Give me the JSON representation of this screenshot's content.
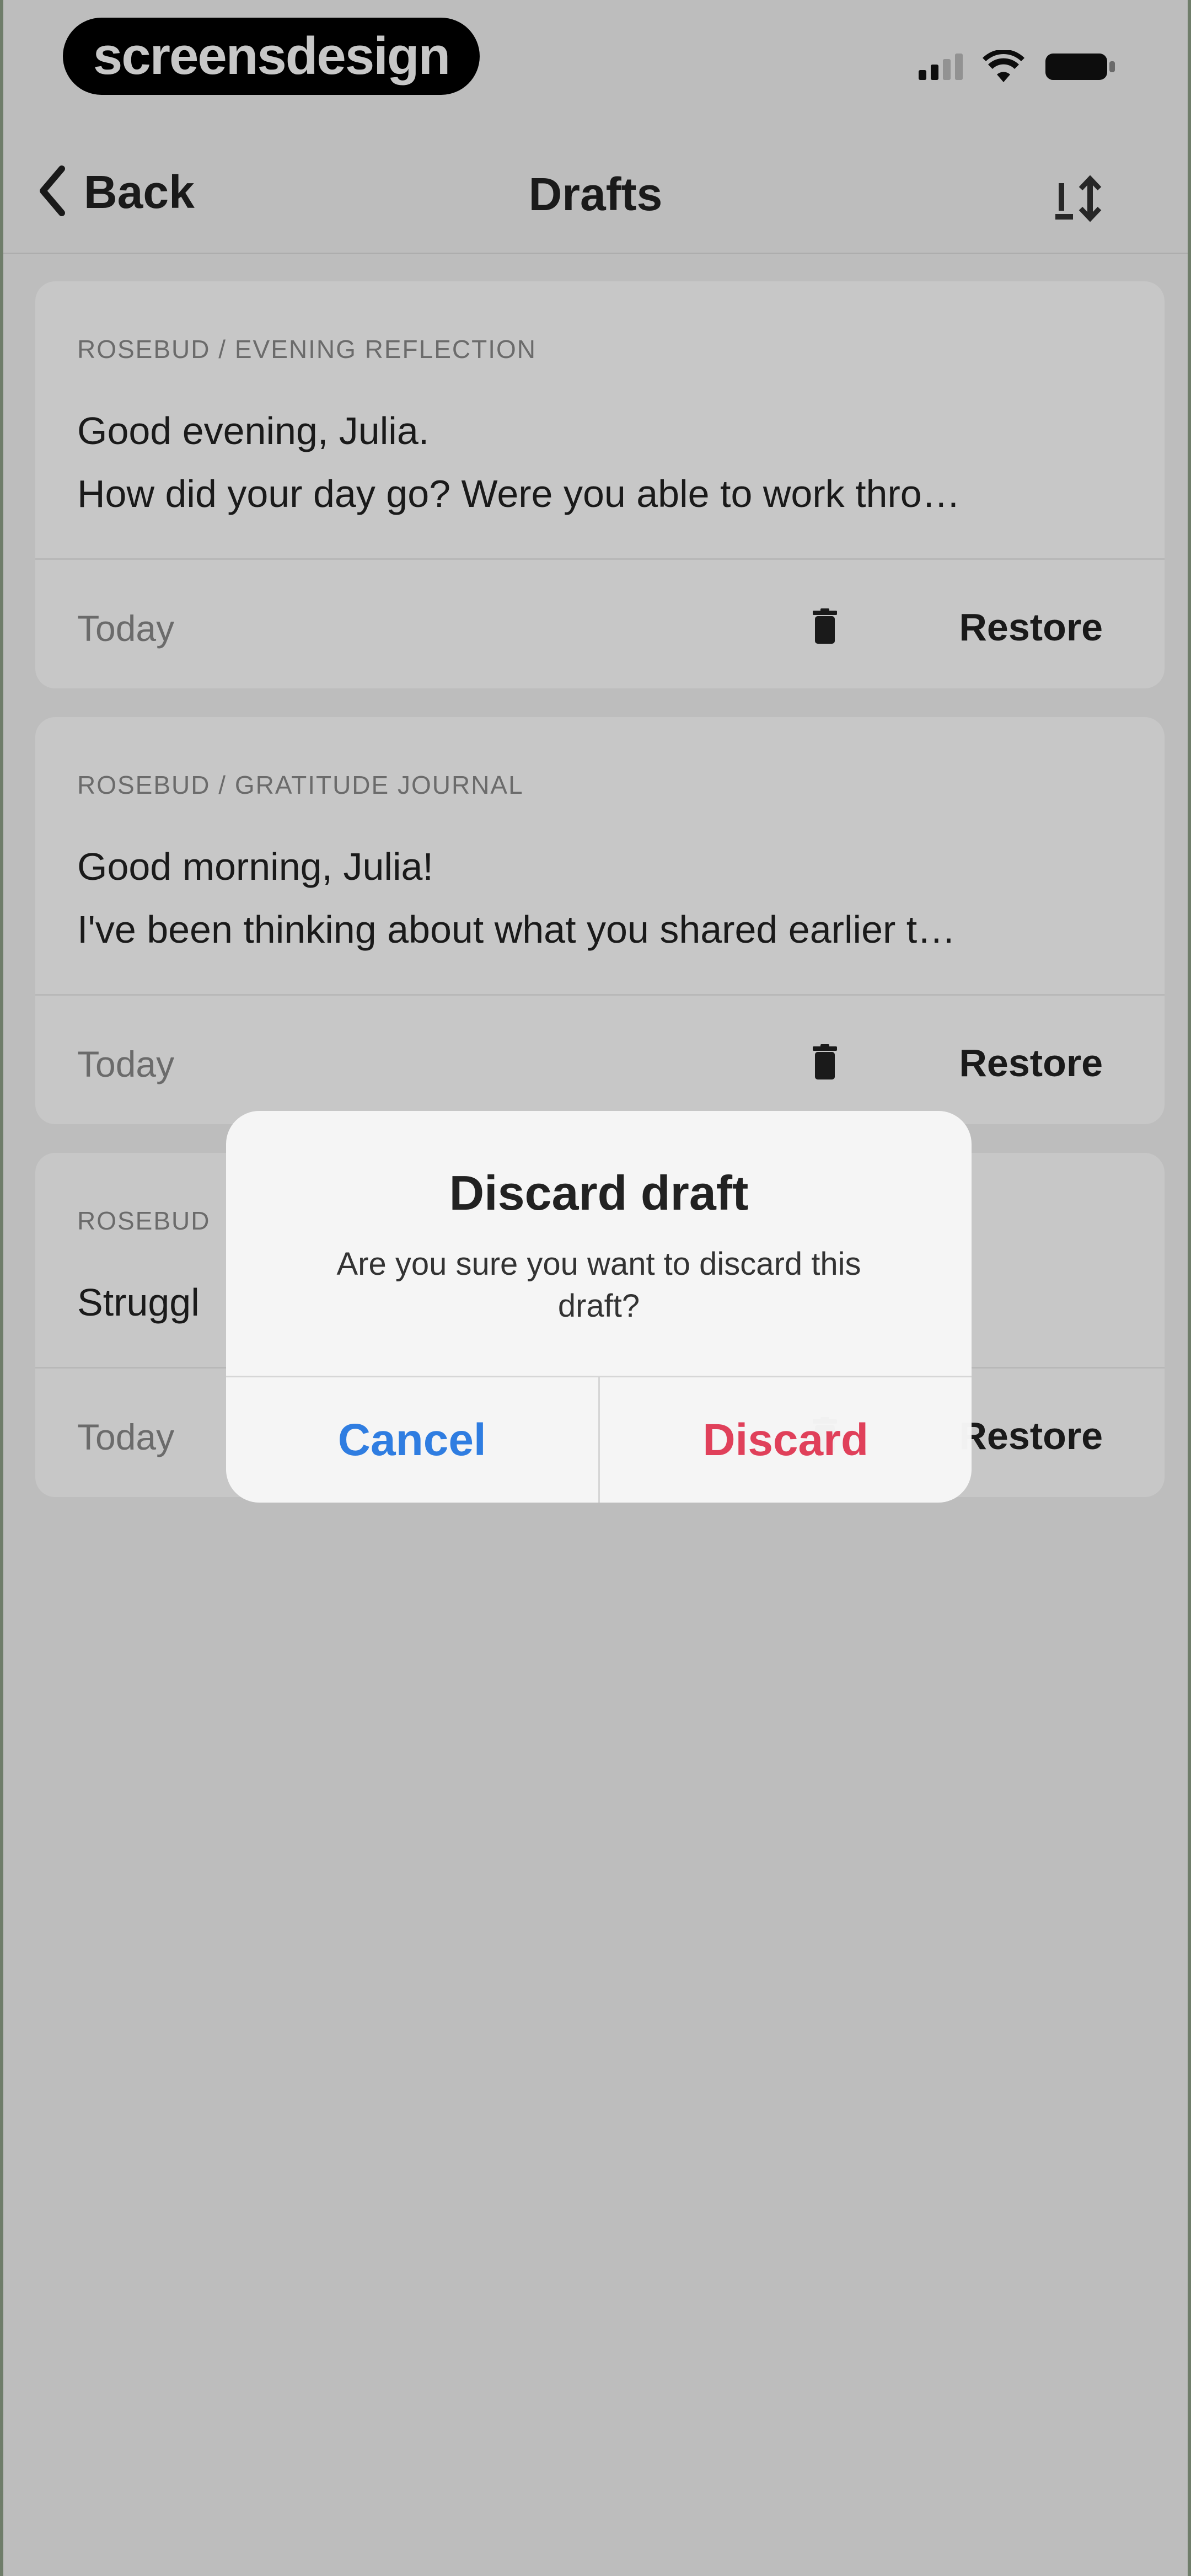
{
  "status_bar": {
    "brand": "screensdesign"
  },
  "nav": {
    "back_label": "Back",
    "title": "Drafts"
  },
  "drafts": [
    {
      "source": "ROSEBUD / EVENING REFLECTION",
      "line1": "Good evening, Julia.",
      "line2": "How did your day go? Were you able to work thro…",
      "date": "Today",
      "restore_label": "Restore"
    },
    {
      "source": "ROSEBUD / GRATITUDE JOURNAL",
      "line1": "Good morning, Julia!",
      "line2": "I've been thinking about what you shared earlier t…",
      "date": "Today",
      "restore_label": "Restore"
    },
    {
      "source": "ROSEBUD",
      "line1": "Struggl",
      "line2": "",
      "date": "Today",
      "restore_label": "Restore"
    }
  ],
  "alert": {
    "title": "Discard draft",
    "message": "Are you sure you want to discard this draft?",
    "cancel_label": "Cancel",
    "discard_label": "Discard"
  },
  "colors": {
    "cancel": "#2f7de1",
    "discard": "#e0405a"
  }
}
